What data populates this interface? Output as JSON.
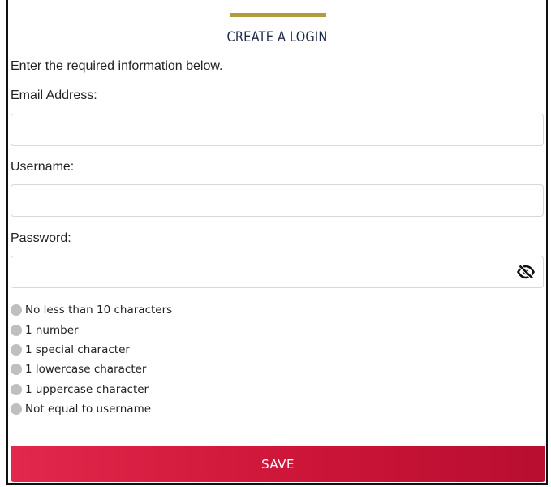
{
  "form": {
    "title": "CREATE A LOGIN",
    "intro": "Enter the required information below.",
    "accent_color": "#b39a3c",
    "email": {
      "label": "Email Address:",
      "value": "",
      "placeholder": ""
    },
    "username": {
      "label": "Username:",
      "value": "",
      "placeholder": ""
    },
    "password": {
      "label": "Password:",
      "value": "",
      "placeholder": "",
      "toggle_icon": "eye-slash-icon"
    },
    "requirements": [
      {
        "text": "No less than 10 characters",
        "met": false
      },
      {
        "text": "1 number",
        "met": false
      },
      {
        "text": "1 special character",
        "met": false
      },
      {
        "text": "1 lowercase character",
        "met": false
      },
      {
        "text": "1 uppercase character",
        "met": false
      },
      {
        "text": "Not equal to username",
        "met": false
      }
    ],
    "save_label": "SAVE",
    "save_color": "#cc1538"
  }
}
